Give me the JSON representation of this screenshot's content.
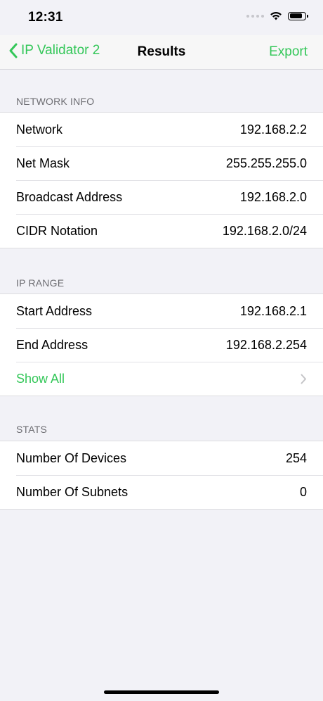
{
  "status_bar": {
    "time": "12:31",
    "battery_level": 0.85
  },
  "nav": {
    "back_label": "IP Validator 2",
    "title": "Results",
    "action_label": "Export"
  },
  "sections": {
    "network_info": {
      "header": "NETWORK INFO",
      "rows": [
        {
          "label": "Network",
          "value": "192.168.2.2"
        },
        {
          "label": "Net Mask",
          "value": "255.255.255.0"
        },
        {
          "label": "Broadcast Address",
          "value": "192.168.2.0"
        },
        {
          "label": "CIDR Notation",
          "value": "192.168.2.0/24"
        }
      ]
    },
    "ip_range": {
      "header": "IP RANGE",
      "rows": [
        {
          "label": "Start Address",
          "value": "192.168.2.1"
        },
        {
          "label": "End Address",
          "value": "192.168.2.254"
        }
      ],
      "show_all_label": "Show All"
    },
    "stats": {
      "header": "STATS",
      "rows": [
        {
          "label": "Number Of Devices",
          "value": "254"
        },
        {
          "label": "Number Of Subnets",
          "value": "0"
        }
      ]
    }
  },
  "colors": {
    "accent": "#34c759",
    "background": "#f2f2f7",
    "section_header": "#6d6d72"
  }
}
